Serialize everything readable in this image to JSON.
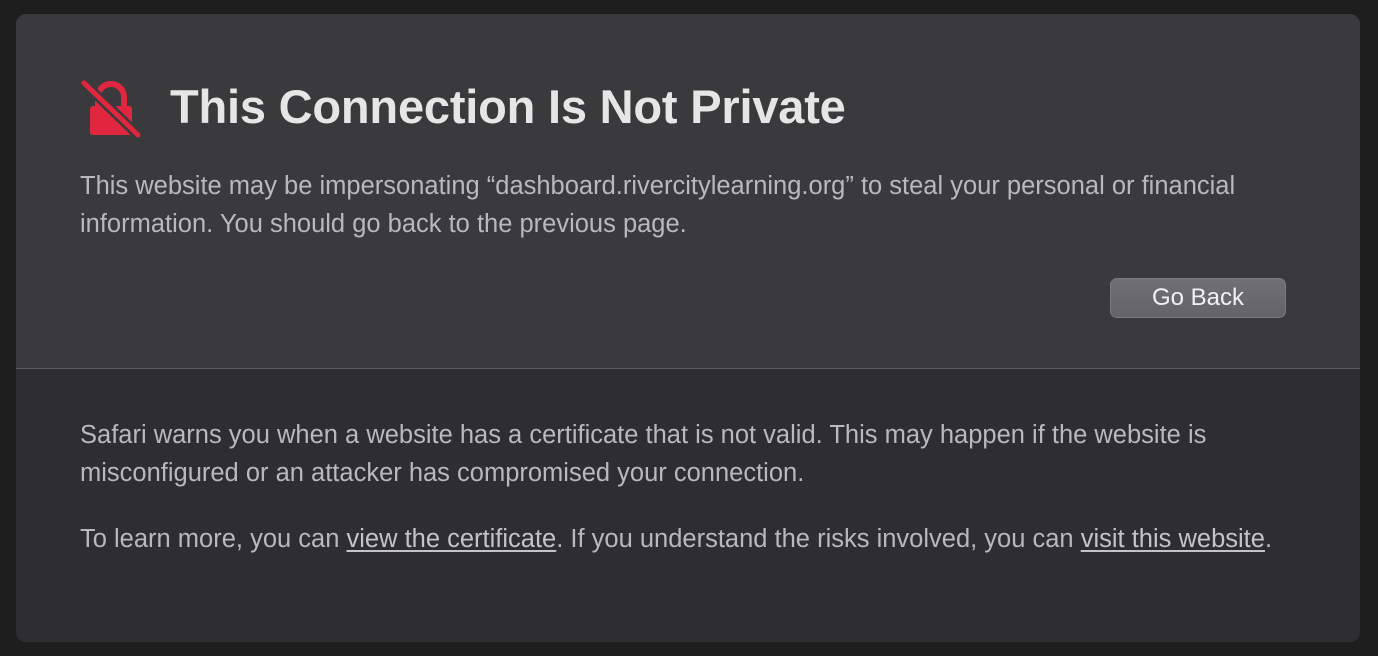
{
  "title": "This Connection Is Not Private",
  "intro_text": "This website may be impersonating “dashboard.rivercitylearning.org” to steal your personal or financial information. You should go back to the previous page.",
  "go_back_label": "Go Back",
  "details_text": "Safari warns you when a website has a certificate that is not valid. This may happen if the website is misconfigured or an attacker has compromised your connection.",
  "learn_more": {
    "prefix": "To learn more, you can ",
    "view_certificate_link": "view the certificate",
    "middle": ". If you understand the risks involved, you can ",
    "visit_website_link": "visit this website",
    "suffix": "."
  },
  "icon": "broken-lock-icon",
  "colors": {
    "accent_red": "#e0273f",
    "header_bg": "#3a3a3c",
    "footer_bg": "#2e2e30"
  }
}
